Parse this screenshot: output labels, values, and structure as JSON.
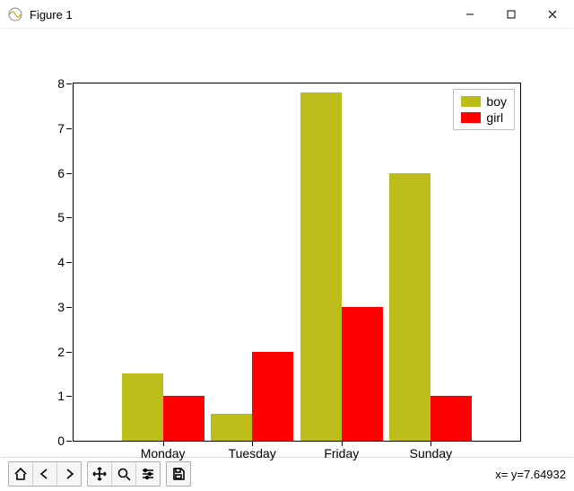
{
  "window": {
    "title": "Figure 1"
  },
  "toolbar": {
    "home": "Home",
    "back": "Back",
    "forward": "Forward",
    "pan": "Pan",
    "zoom": "Zoom",
    "configure": "Configure subplots",
    "save": "Save"
  },
  "status": {
    "text": "x= y=7.64932"
  },
  "legend": {
    "items": [
      {
        "label": "boy",
        "color": "#bdbd1a"
      },
      {
        "label": "girl",
        "color": "#ff0000"
      }
    ]
  },
  "chart_data": {
    "type": "bar",
    "categories": [
      "Monday",
      "Tuesday",
      "Friday",
      "Sunday"
    ],
    "series": [
      {
        "name": "boy",
        "values": [
          1.5,
          0.6,
          7.8,
          6.0
        ],
        "color": "#bdbd1a"
      },
      {
        "name": "girl",
        "values": [
          1.0,
          2.0,
          3.0,
          1.0
        ],
        "color": "#ff0000"
      }
    ],
    "title": "",
    "xlabel": "",
    "ylabel": "",
    "ylim": [
      0,
      8
    ],
    "yticks": [
      0,
      1,
      2,
      3,
      4,
      5,
      6,
      7,
      8
    ],
    "legend_position": "upper right",
    "grid": false
  }
}
